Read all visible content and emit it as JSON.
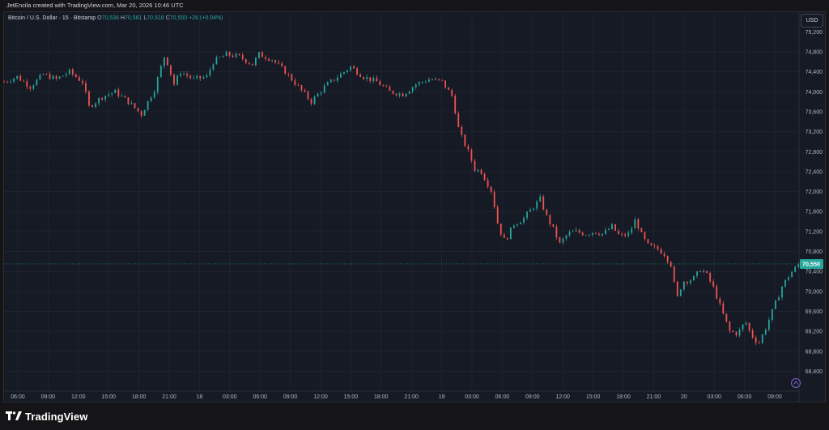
{
  "header": {
    "credit": "JetEncila created with TradingView.com, Mar 20, 2026 10:46 UTC"
  },
  "legend": {
    "symbol": "Bitcoin / U.S. Dollar · 15 · Bitstamp",
    "o_label": "O",
    "o_value": "70,536",
    "h_label": "H",
    "h_value": "70,561",
    "l_label": "L",
    "l_value": "70,518",
    "c_label": "C",
    "c_value": "70,550",
    "change": "+26 (+0.04%)"
  },
  "currency_button": "USD",
  "last_price_label": "70,550",
  "brand": {
    "name": "TradingView"
  },
  "colors": {
    "up": "#26a69a",
    "down": "#ef5350",
    "background": "#161a25",
    "grid": "#1f2330",
    "axis_text": "#b2b5be"
  },
  "chart_data": {
    "type": "candlestick",
    "title": "Bitcoin / U.S. Dollar · 15 · Bitstamp",
    "ylim": [
      68100,
      75400
    ],
    "y_ticks": [
      75200,
      74800,
      74400,
      74000,
      73600,
      73200,
      72800,
      72400,
      72000,
      71600,
      71200,
      70800,
      70400,
      70000,
      69600,
      69200,
      68800,
      68400
    ],
    "x_ticks": [
      "06:00",
      "09:00",
      "12:00",
      "15:00",
      "18:00",
      "21:00",
      "18",
      "03:00",
      "06:00",
      "09:00",
      "12:00",
      "15:00",
      "18:00",
      "21:00",
      "19",
      "03:00",
      "06:00",
      "09:00",
      "12:00",
      "15:00",
      "18:00",
      "21:00",
      "20",
      "03:00",
      "06:00",
      "09:00"
    ],
    "x_range_hours": [
      -2.5,
      58.3
    ],
    "grid": true,
    "last_price": 70550,
    "close_path": [
      [
        -2.5,
        74200
      ],
      [
        -1.5,
        74300
      ],
      [
        -0.5,
        74100
      ],
      [
        0.5,
        74350
      ],
      [
        1.5,
        74250
      ],
      [
        2.5,
        74400
      ],
      [
        3.5,
        74200
      ],
      [
        4.0,
        73700
      ],
      [
        5.0,
        73900
      ],
      [
        6.0,
        74000
      ],
      [
        7.0,
        73800
      ],
      [
        8.0,
        73550
      ],
      [
        9.0,
        74050
      ],
      [
        9.8,
        74750
      ],
      [
        10.5,
        74150
      ],
      [
        11.0,
        74400
      ],
      [
        12.0,
        74250
      ],
      [
        13.0,
        74300
      ],
      [
        13.5,
        74600
      ],
      [
        14.5,
        74750
      ],
      [
        15.5,
        74700
      ],
      [
        16.5,
        74550
      ],
      [
        17.0,
        74750
      ],
      [
        18.0,
        74650
      ],
      [
        19.0,
        74400
      ],
      [
        20.0,
        74100
      ],
      [
        21.0,
        73800
      ],
      [
        22.0,
        74100
      ],
      [
        23.0,
        74300
      ],
      [
        24.0,
        74500
      ],
      [
        25.0,
        74300
      ],
      [
        26.0,
        74200
      ],
      [
        27.0,
        74000
      ],
      [
        28.0,
        73950
      ],
      [
        29.0,
        74150
      ],
      [
        30.0,
        74250
      ],
      [
        31.0,
        74200
      ],
      [
        31.8,
        73900
      ],
      [
        32.3,
        73200
      ],
      [
        33.0,
        72800
      ],
      [
        33.5,
        72450
      ],
      [
        34.0,
        72400
      ],
      [
        34.8,
        72000
      ],
      [
        35.3,
        71300
      ],
      [
        35.8,
        71000
      ],
      [
        36.5,
        71350
      ],
      [
        37.2,
        71450
      ],
      [
        38.0,
        71700
      ],
      [
        38.5,
        71850
      ],
      [
        39.0,
        71500
      ],
      [
        39.6,
        71200
      ],
      [
        40.0,
        70950
      ],
      [
        40.6,
        71150
      ],
      [
        41.2,
        71200
      ],
      [
        42.0,
        71150
      ],
      [
        42.6,
        71200
      ],
      [
        43.3,
        71150
      ],
      [
        44.0,
        71300
      ],
      [
        44.6,
        71100
      ],
      [
        45.3,
        71150
      ],
      [
        45.8,
        71450
      ],
      [
        46.3,
        71100
      ],
      [
        46.8,
        70900
      ],
      [
        47.5,
        70850
      ],
      [
        48.0,
        70750
      ],
      [
        48.6,
        70500
      ],
      [
        48.9,
        69800
      ],
      [
        49.4,
        70200
      ],
      [
        50.2,
        70250
      ],
      [
        50.8,
        70450
      ],
      [
        51.2,
        70350
      ],
      [
        51.8,
        70050
      ],
      [
        52.4,
        69600
      ],
      [
        53.0,
        69200
      ],
      [
        53.6,
        69150
      ],
      [
        54.2,
        69400
      ],
      [
        54.6,
        69150
      ],
      [
        55.2,
        68950
      ],
      [
        55.8,
        69300
      ],
      [
        56.4,
        69700
      ],
      [
        57.0,
        70100
      ],
      [
        57.6,
        70350
      ],
      [
        58.3,
        70550
      ]
    ]
  }
}
